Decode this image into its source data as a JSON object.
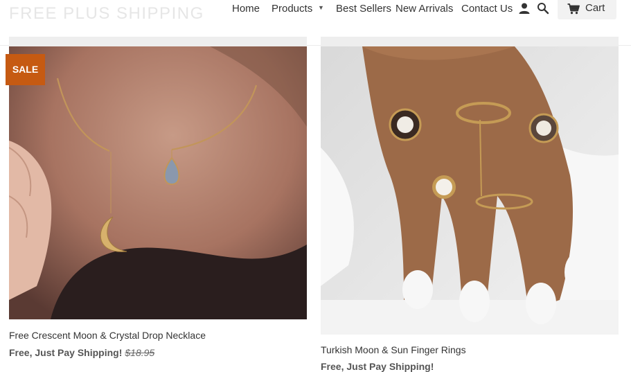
{
  "header": {
    "logo_text": "FREE PLUS SHIPPING",
    "nav": {
      "home": "Home",
      "products": "Products",
      "products_caret": "▼",
      "best_sellers": "Best Sellers",
      "new_arrivals": "New Arrivals",
      "contact_us": "Contact Us"
    },
    "account_icon": "user-icon",
    "search_icon": "search-icon",
    "cart": {
      "icon": "cart-icon",
      "label": "Cart"
    }
  },
  "products": [
    {
      "title": "Free Crescent Moon & Crystal Drop Necklace",
      "price": "Free, Just Pay Shipping!",
      "compare_price": "$18.95",
      "badge": "SALE"
    },
    {
      "title": "Turkish Moon & Sun Finger Rings",
      "price": "Free, Just Pay Shipping!"
    }
  ],
  "colors": {
    "sale_badge": "#c65a12",
    "logo": "#e6e6e6",
    "text": "#333333"
  }
}
